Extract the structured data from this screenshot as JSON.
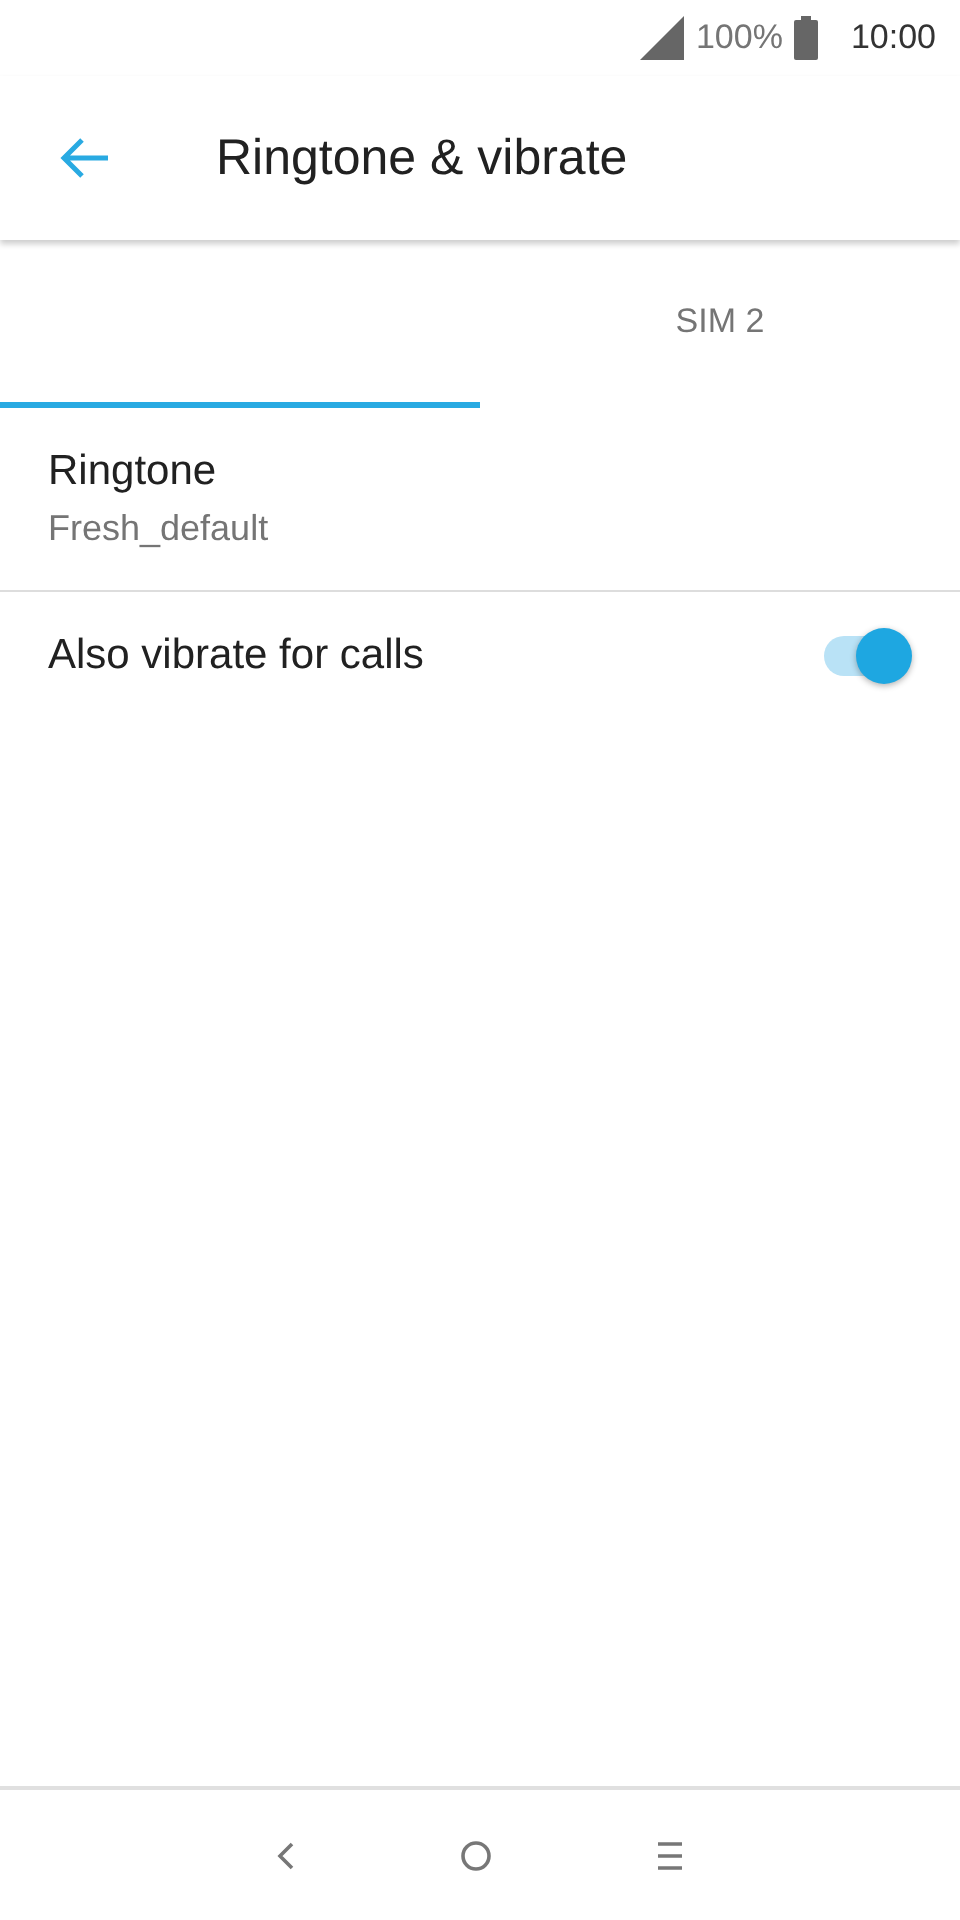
{
  "status_bar": {
    "battery": "100%",
    "time": "10:00"
  },
  "toolbar": {
    "title": "Ringtone & vibrate"
  },
  "tabs": [
    {
      "selected": true
    },
    {
      "label": "SIM 2",
      "selected": false
    }
  ],
  "settings": [
    {
      "kind": "text",
      "title": "Ringtone",
      "summary": "Fresh_default"
    },
    {
      "kind": "switch",
      "title": "Also vibrate for calls",
      "on": true
    }
  ]
}
